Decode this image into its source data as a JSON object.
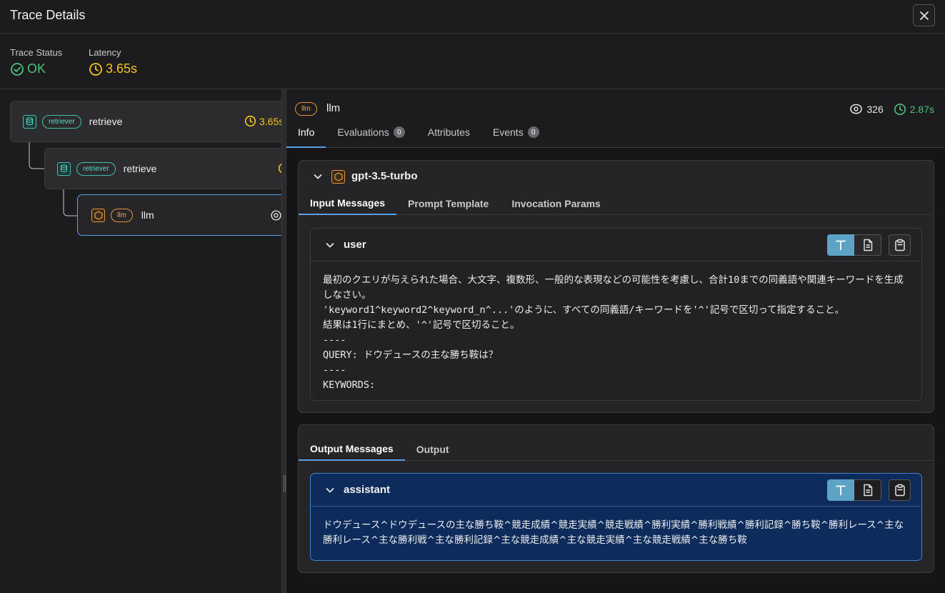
{
  "window": {
    "title": "Trace Details"
  },
  "summary": {
    "status_label": "Trace Status",
    "status_value": "OK",
    "latency_label": "Latency",
    "latency_value": "3.65s"
  },
  "tree": {
    "spans": [
      {
        "kind": "retriever",
        "name": "retrieve",
        "latency": "3.65s"
      },
      {
        "kind": "retriever",
        "name": "retrieve",
        "latency": ""
      },
      {
        "kind": "llm",
        "name": "llm",
        "latency": ""
      }
    ]
  },
  "detail": {
    "kind": "llm",
    "name": "llm",
    "tokens": "326",
    "latency": "2.87s",
    "tabs": [
      {
        "label": "Info",
        "count": ""
      },
      {
        "label": "Evaluations",
        "count": "0"
      },
      {
        "label": "Attributes",
        "count": ""
      },
      {
        "label": "Events",
        "count": "0"
      }
    ]
  },
  "model": {
    "name": "gpt-3.5-turbo",
    "subtabs": [
      "Input Messages",
      "Prompt Template",
      "Invocation Params"
    ]
  },
  "input_message": {
    "role": "user",
    "content": "最初のクエリが与えられた場合、大文字、複数形、一般的な表現などの可能性を考慮し、合計10までの同義語や関連キーワードを生成しなさい。\n'keyword1^keyword2^keyword_n^...'のように、すべての同義語/キーワードを'^'記号で区切って指定すること。\n結果は1行にまとめ、'^'記号で区切ること。\n----\nQUERY: ドウデュースの主な勝ち鞍は？\n----\nKEYWORDS:"
  },
  "output": {
    "subtabs": [
      "Output Messages",
      "Output"
    ]
  },
  "output_message": {
    "role": "assistant",
    "content": "ドウデュース^ドウデュースの主な勝ち鞍^競走成績^競走実績^競走戦績^勝利実績^勝利戦績^勝利記録^勝ち鞍^勝利レース^主な勝利レース^主な勝利戦^主な勝利記録^主な競走成績^主な競走実績^主な競走戦績^主な勝ち鞍"
  },
  "colors": {
    "accent": "#5aa0e6",
    "ok": "#4ec27a",
    "latency": "#f5c518",
    "retriever": "#3fc1b0",
    "llm": "#e8943a"
  }
}
